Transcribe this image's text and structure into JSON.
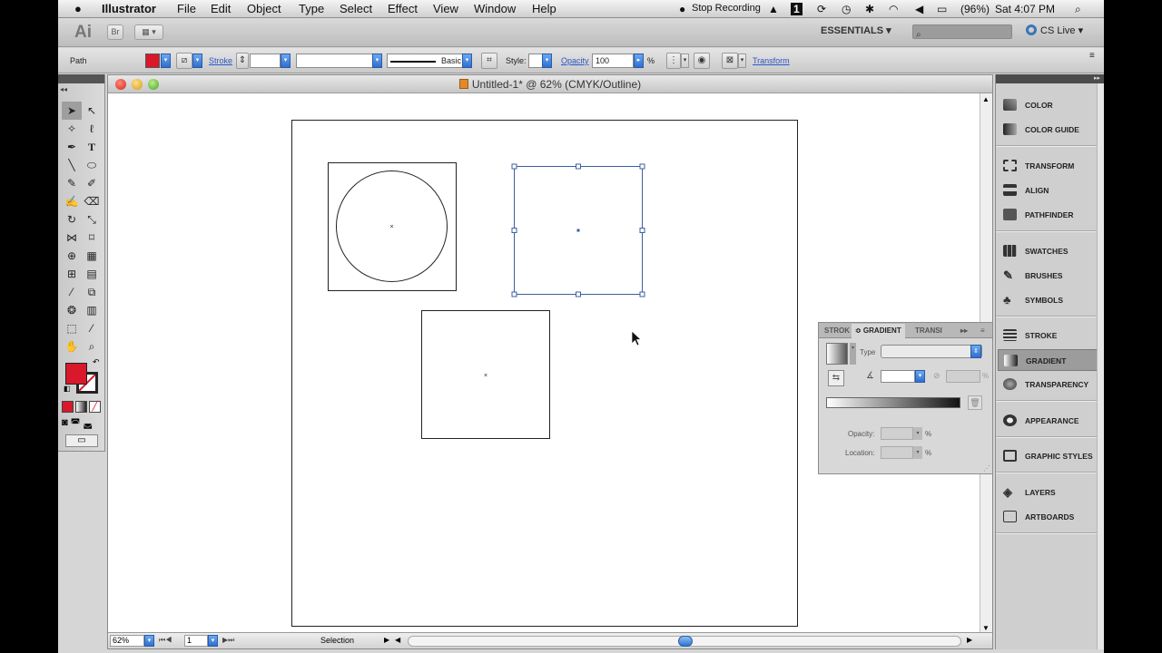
{
  "menubar": {
    "apple": "",
    "app": "Illustrator",
    "menus": [
      "File",
      "Edit",
      "Object",
      "Type",
      "Select",
      "Effect",
      "View",
      "Window",
      "Help"
    ],
    "recording": "Stop Recording",
    "badge": "1",
    "battery": "(96%)",
    "clock": "Sat 4:07 PM"
  },
  "appbar": {
    "logo": "Ai",
    "bridge": "Br",
    "workspace": "ESSENTIALS ▾",
    "cslive": "CS Live ▾"
  },
  "control": {
    "object_type": "Path",
    "stroke_label": "Stroke",
    "brush": "Basic",
    "style_label": "Style:",
    "opacity_label": "Opacity",
    "opacity_value": "100",
    "percent": "%",
    "transform_label": "Transform",
    "colors": {
      "fill": "#d9182b",
      "link": "#2b56c8"
    }
  },
  "document": {
    "title": "Untitled-1* @ 62% (CMYK/Outline)",
    "zoom": "62%",
    "page": "1",
    "status": "Selection"
  },
  "gradient_panel": {
    "tabs": [
      "STROK",
      "≎ GRADIENT",
      "TRANSI"
    ],
    "type_label": "Type",
    "opacity_label": "Opacity:",
    "location_label": "Location:",
    "percent": "%"
  },
  "dock": {
    "items": [
      "COLOR",
      "COLOR GUIDE",
      "TRANSFORM",
      "ALIGN",
      "PATHFINDER",
      "SWATCHES",
      "BRUSHES",
      "SYMBOLS",
      "STROKE",
      "GRADIENT",
      "TRANSPARENCY",
      "APPEARANCE",
      "GRAPHIC STYLES",
      "LAYERS",
      "ARTBOARDS"
    ],
    "active": "GRADIENT"
  },
  "tools": {
    "type_tool_glyph": "T"
  }
}
